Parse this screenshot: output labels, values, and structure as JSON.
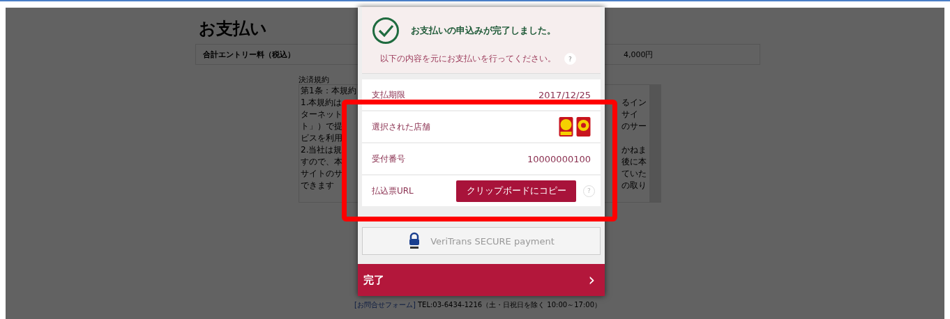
{
  "page": {
    "title": "お支払い",
    "fee": {
      "label": "合計エントリー料（税込）",
      "value": "4,000円"
    },
    "terms": {
      "heading": "決済規約",
      "lines": [
        {
          "left": "第1条：本規約"
        },
        {
          "left": "1.本規約は",
          "right": "るイン"
        },
        {
          "left": "ターネット",
          "right": "サイ"
        },
        {
          "left": "ト」）で提",
          "right": "のサー"
        },
        {
          "left": "ビスを利用"
        },
        {
          "left": "2.当社は規",
          "right": "かねま"
        },
        {
          "left": "すので、本",
          "right": "後に本"
        },
        {
          "left": "サイトのサ",
          "right": "ていた"
        },
        {
          "left": "できます",
          "right": "の取り"
        }
      ]
    },
    "footer": {
      "link": "[お問合せフォーム]",
      "text": "TEL:03-6434-1216（土・日祝日を除く 10:00～17:00）"
    }
  },
  "dialog": {
    "message": "お支払いの申込みが完了しました。",
    "instruction": "以下の内容を元にお支払いを行ってください。",
    "help_mark": "?",
    "rows": [
      {
        "kind": "text",
        "label": "支払期限",
        "value": "2017/12/25"
      },
      {
        "kind": "stores",
        "label": "選択された店舗"
      },
      {
        "kind": "text",
        "label": "受付番号",
        "value": "10000000100"
      },
      {
        "kind": "button",
        "label": "払込票URL",
        "button": "クリップボードにコピー",
        "help_mark": "?"
      }
    ],
    "secure_badge": "VeriTrans SECURE payment",
    "done_button": "完了",
    "done_chevron": "›"
  }
}
